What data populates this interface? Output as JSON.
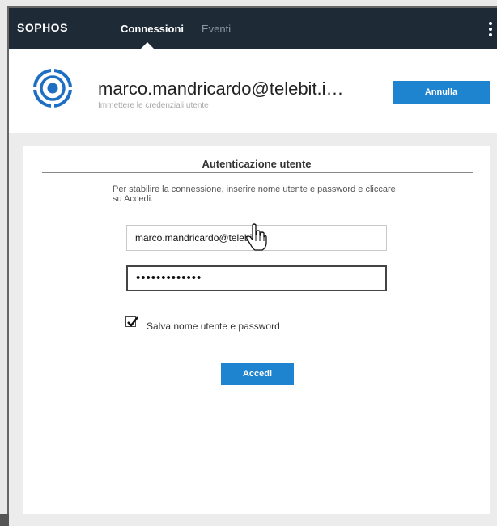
{
  "nav": {
    "logo": "SOPHOS",
    "tabs": [
      {
        "label": "Connessioni",
        "active": true
      },
      {
        "label": "Eventi",
        "active": false
      }
    ],
    "menu_icon": "kebab-menu-icon"
  },
  "header": {
    "icon": "profile-target-icon",
    "title": "marco.mandricardo@telebit.i…",
    "subtitle": "Immettere le credenziali utente",
    "cancel_label": "Annulla"
  },
  "auth": {
    "title": "Autenticazione utente",
    "instructions": "Per stabilire la connessione, inserire nome utente e password e cliccare su Accedi.",
    "username_value": "marco.mandricardo@telebit.it",
    "password_value": "•••••••••••••",
    "save_checkbox_checked": true,
    "save_label": "Salva nome utente e password",
    "submit_label": "Accedi"
  },
  "colors": {
    "nav_bg": "#1f2a37",
    "accent": "#1f84d0",
    "body_bg": "#ececec"
  }
}
